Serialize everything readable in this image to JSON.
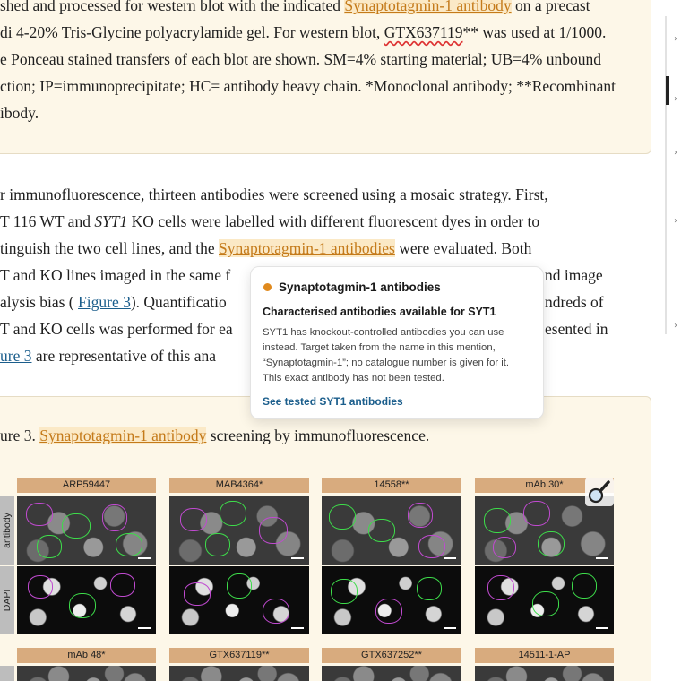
{
  "legend": {
    "line1_a": "shed and processed for western blot with the indicated ",
    "line1_link": "Synaptotagmin-1 antibody",
    "line1_b": " on a precast",
    "line2_a": "di 4-20% Tris-Glycine polyacrylamide gel. For western blot, ",
    "line2_code": "GTX637119",
    "line2_b": "** was used at 1/1000.",
    "line3": "e Ponceau stained transfers of each blot are shown. SM=4% starting material; UB=4% unbound",
    "line4": "ction; IP=immunoprecipitate; HC= antibody heavy chain. *Monoclonal antibody; **Recombinant",
    "line5": "ibody."
  },
  "paragraph": {
    "line1": "r immunofluorescence, thirteen antibodies were screened using a mosaic strategy. First,",
    "line2_a": "T 116 WT and ",
    "line2_italic": "SYT1",
    "line2_b": " KO cells were labelled with different fluorescent dyes in order to",
    "line3_a": "tinguish the two cell lines, and the ",
    "line3_link": "Synaptotagmin-1 antibodies",
    "line3_b": " were evaluated. Both",
    "line4_a": "T and KO lines imaged in the same f",
    "line4_b": "nd image",
    "line5_a": "alysis bias ( ",
    "line5_link": "Figure 3",
    "line5_b": "). Quantificatio",
    "line5_c": "ndreds of",
    "line6_a": "T and KO cells was performed for ea",
    "line6_b": "esented in",
    "line7_link": "ure 3",
    "line7_b": " are representative of this ana"
  },
  "figure": {
    "caption_a": "ure 3. ",
    "caption_link": "Synaptotagmin-1 antibody",
    "caption_b": " screening by immunofluorescence.",
    "row1_headers": [
      "ARP59447",
      "MAB4364*",
      "14558**",
      "mAb 30*"
    ],
    "row2_headers": [
      "mAb 48*",
      "GTX637119**",
      "GTX637252**",
      "14511-1-AP"
    ],
    "row_labels": [
      "antibody",
      "DAPI"
    ]
  },
  "popover": {
    "title": "Synaptotagmin-1 antibodies",
    "subtitle": "Characterised antibodies available for SYT1",
    "body_lines": [
      "SYT1 has knockout-controlled antibodies you can use",
      "instead. Target taken from the name in this mention,",
      "“Synaptotagmin-1”; no catalogue number is given for it.",
      "This exact antibody has not been tested."
    ],
    "link": "See tested SYT1 antibodies",
    "dot_color": "#e08a1e"
  },
  "colors": {
    "accent_link": "#c47a1a",
    "blue_link": "#1b5e8c",
    "panel_bg": "#fdf7e8",
    "header_bg": "#d8ab7e"
  }
}
